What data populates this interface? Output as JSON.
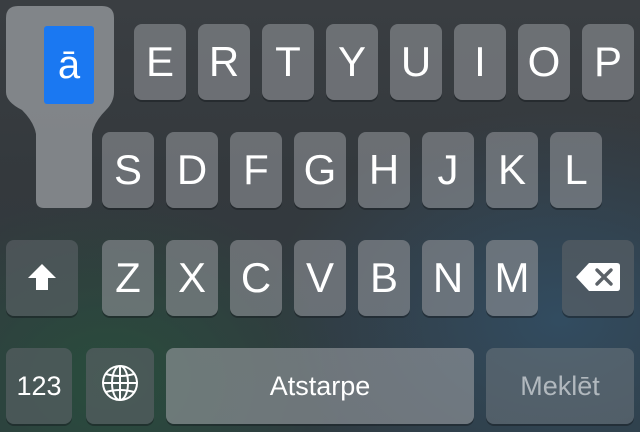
{
  "popup": {
    "alternate": "ā"
  },
  "rows": {
    "top": [
      "E",
      "R",
      "T",
      "Y",
      "U",
      "I",
      "O",
      "P"
    ],
    "middle": [
      "S",
      "D",
      "F",
      "G",
      "H",
      "J",
      "K",
      "L"
    ],
    "bottom": [
      "Z",
      "X",
      "C",
      "V",
      "B",
      "N",
      "M"
    ]
  },
  "function_keys": {
    "numbers": "123",
    "space": "Atstarpe",
    "search": "Meklēt"
  },
  "icons": {
    "shift": "shift-icon",
    "delete": "delete-icon",
    "globe": "globe-icon"
  },
  "colors": {
    "highlight": "#1a78f2"
  }
}
